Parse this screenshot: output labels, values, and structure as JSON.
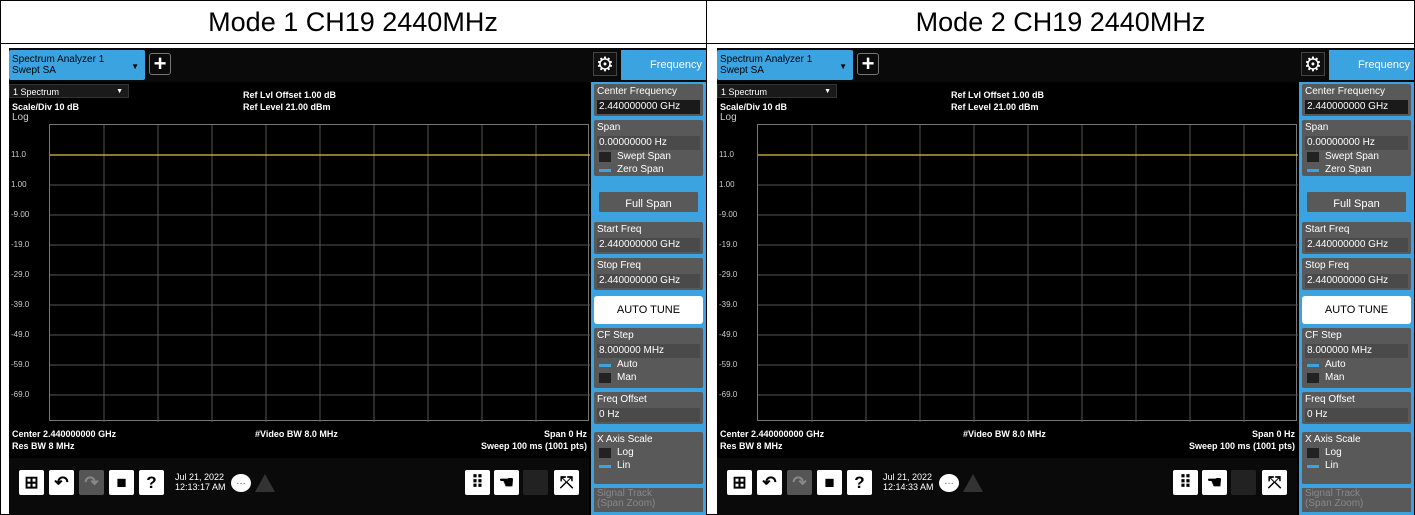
{
  "panels": [
    {
      "caption": "Mode 1 CH19 2440MHz",
      "tab_line1": "Spectrum Analyzer 1",
      "tab_line2": "Swept SA",
      "freq_tab": "Frequency",
      "spectrum_dd": "1 Spectrum",
      "scale_div": "Scale/Div 10 dB",
      "log_label": "Log",
      "ref_offset": "Ref Lvl Offset 1.00 dB",
      "ref_level": "Ref Level 21.00 dBm",
      "y_ticks": [
        "11.0",
        "1.00",
        "-9.00",
        "-19.0",
        "-29.0",
        "-39.0",
        "-49.0",
        "-59.0",
        "-69.0"
      ],
      "center": "Center 2.440000000 GHz",
      "res_bw": "Res BW 8 MHz",
      "video_bw": "#Video BW 8.0 MHz",
      "span": "Span 0 Hz",
      "sweep": "Sweep 100 ms (1001 pts)",
      "date_line1": "Jul 21, 2022",
      "date_line2": "12:13:17 AM",
      "softkeys": {
        "center_label": "Center Frequency",
        "center_value": "2.440000000 GHz",
        "span_label": "Span",
        "span_value": "0.00000000 Hz",
        "swept_span": "Swept Span",
        "zero_span": "Zero Span",
        "full_span": "Full Span",
        "start_label": "Start Freq",
        "start_value": "2.440000000 GHz",
        "stop_label": "Stop Freq",
        "stop_value": "2.440000000 GHz",
        "auto_tune": "AUTO TUNE",
        "cf_step_label": "CF Step",
        "cf_step_value": "8.000000 MHz",
        "auto": "Auto",
        "man": "Man",
        "freq_offset_label": "Freq Offset",
        "freq_offset_value": "0 Hz",
        "x_axis_label": "X Axis Scale",
        "log": "Log",
        "lin": "Lin",
        "signal_track": "Signal Track",
        "span_zoom": "(Span Zoom)"
      }
    },
    {
      "caption": "Mode 2 CH19 2440MHz",
      "tab_line1": "Spectrum Analyzer 1",
      "tab_line2": "Swept SA",
      "freq_tab": "Frequency",
      "spectrum_dd": "1 Spectrum",
      "scale_div": "Scale/Div 10 dB",
      "log_label": "Log",
      "ref_offset": "Ref Lvl Offset 1.00 dB",
      "ref_level": "Ref Level 21.00 dBm",
      "y_ticks": [
        "11.0",
        "1.00",
        "-9.00",
        "-19.0",
        "-29.0",
        "-39.0",
        "-49.0",
        "-59.0",
        "-69.0"
      ],
      "center": "Center 2.440000000 GHz",
      "res_bw": "Res BW 8 MHz",
      "video_bw": "#Video BW 8.0 MHz",
      "span": "Span 0 Hz",
      "sweep": "Sweep 100 ms (1001 pts)",
      "date_line1": "Jul 21, 2022",
      "date_line2": "12:14:33 AM",
      "softkeys": {
        "center_label": "Center Frequency",
        "center_value": "2.440000000 GHz",
        "span_label": "Span",
        "span_value": "0.00000000 Hz",
        "swept_span": "Swept Span",
        "zero_span": "Zero Span",
        "full_span": "Full Span",
        "start_label": "Start Freq",
        "start_value": "2.440000000 GHz",
        "stop_label": "Stop Freq",
        "stop_value": "2.440000000 GHz",
        "auto_tune": "AUTO TUNE",
        "cf_step_label": "CF Step",
        "cf_step_value": "8.000000 MHz",
        "auto": "Auto",
        "man": "Man",
        "freq_offset_label": "Freq Offset",
        "freq_offset_value": "0 Hz",
        "x_axis_label": "X Axis Scale",
        "log": "Log",
        "lin": "Lin",
        "signal_track": "Signal Track",
        "span_zoom": "(Span Zoom)"
      }
    }
  ],
  "trace_color": "#e0c040",
  "accent_color": "#3aa3e0"
}
